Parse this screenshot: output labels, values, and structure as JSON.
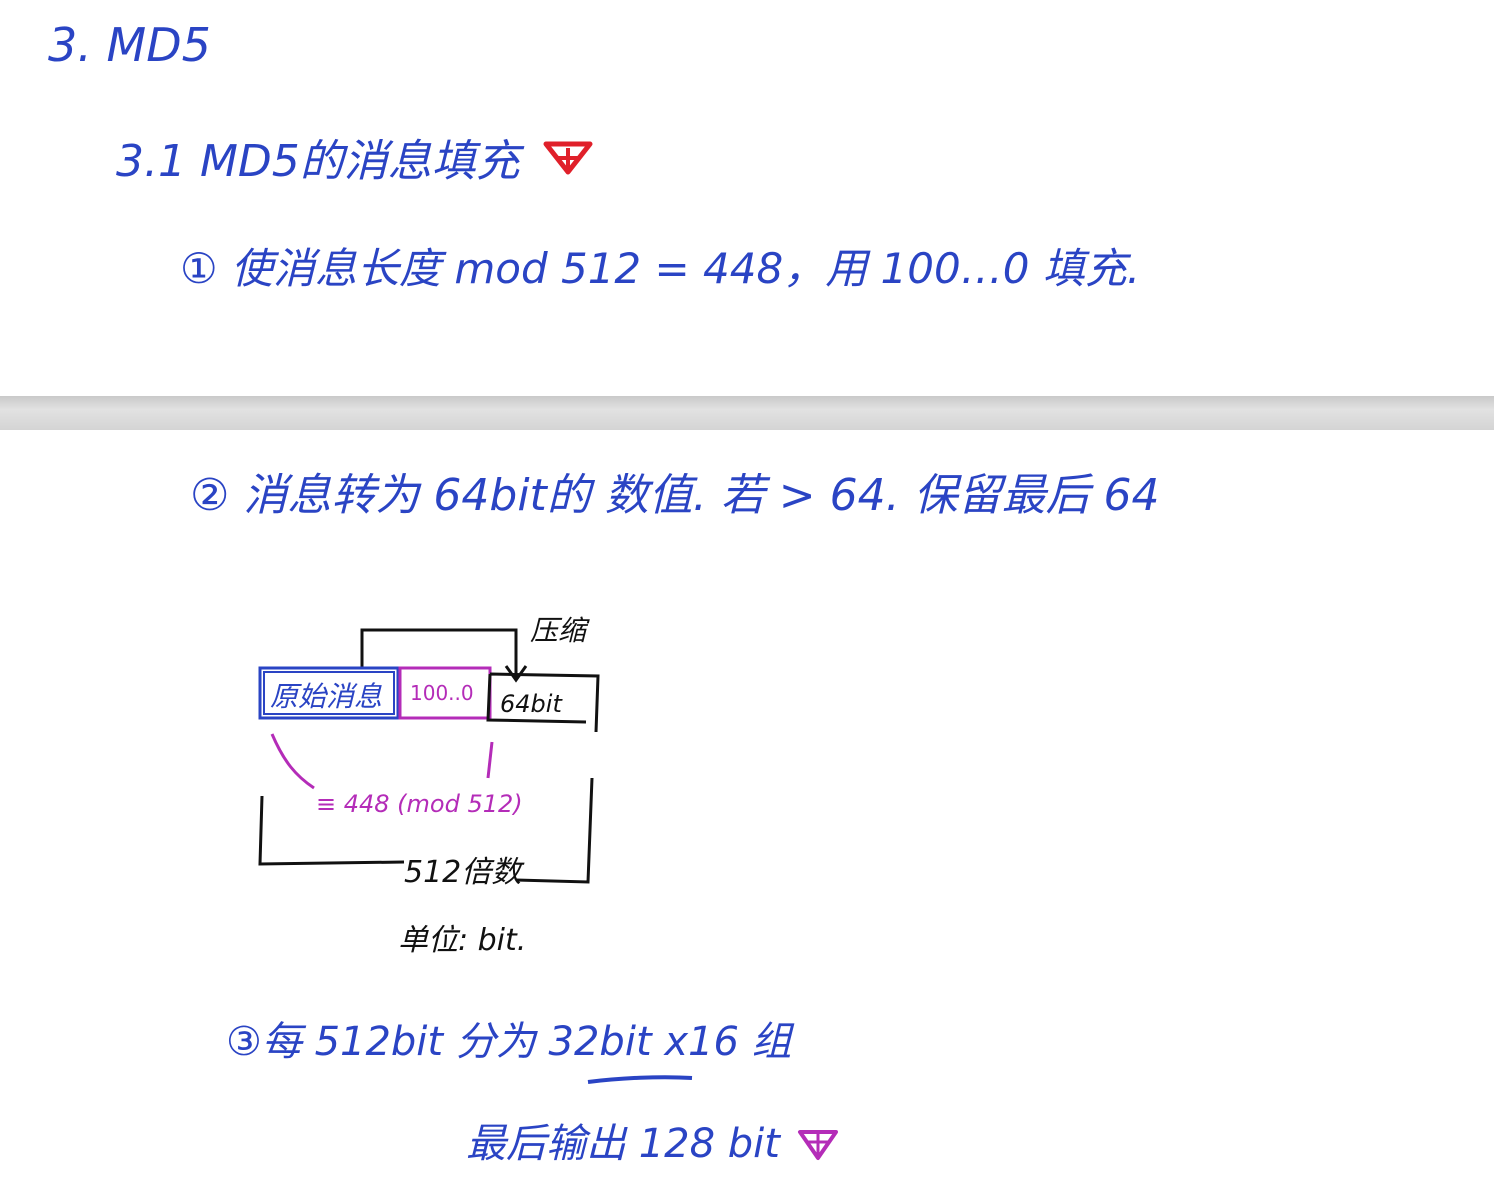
{
  "notes": {
    "heading": "3. MD5",
    "subheading": "3.1 MD5的消息填充",
    "step1": "① 使消息长度 mod 512 = 448，用 100…0 填充.",
    "step2": "② 消息转为 64bit的 数值. 若 > 64. 保留最后 64",
    "step3_prefix": "③每 512bit 分为 32bit ",
    "step3_emph": "x16 组",
    "result": "最后输出 128 bit"
  },
  "diagram": {
    "original_message": "原始消息",
    "padding_block": "100..0",
    "length_block": "64bit",
    "compress_label": "压缩",
    "congruence_label": "≡ 448 (mod 512)",
    "multiple_label": "512倍数",
    "unit_label": "单位: bit."
  },
  "colors": {
    "blue_ink": "#2a44c4",
    "black_ink": "#111111",
    "magenta_ink": "#b42cb8",
    "red_mark": "#e0202a",
    "page_gap": "#d0d0d0"
  }
}
